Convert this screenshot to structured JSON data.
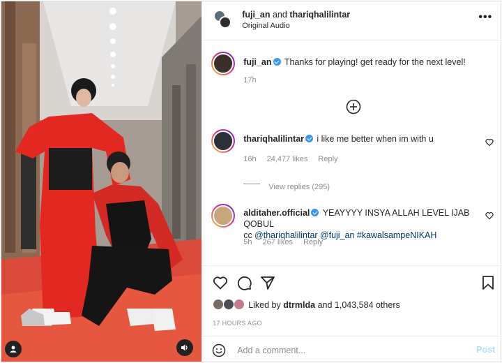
{
  "header": {
    "user1": "fuji_an",
    "joiner": "and",
    "user2": "thariqhalilintar",
    "subtitle": "Original Audio",
    "more": "•••"
  },
  "caption": {
    "username": "fuji_an",
    "text": "Thanks for playing! get ready for the next level!",
    "time": "17h"
  },
  "comments": [
    {
      "username": "thariqhalilintar",
      "text": "i like me better when im with u",
      "time": "16h",
      "likes": "24,477 likes",
      "reply": "Reply"
    },
    {
      "username": "alditaher.official",
      "line1": "YEAYYYY INSYA ALLAH LEVEL IJAB QOBUL",
      "prefix": "cc",
      "mention1": "@thariqhalilintar",
      "mention2": "@fuji_an",
      "hashtag": "#kawalsampeNIKAH",
      "time": "5h",
      "likes": "267 likes",
      "reply": "Reply"
    }
  ],
  "view_replies": "View replies (295)",
  "likes": {
    "prefix": "Liked by",
    "user": "dtrmlda",
    "suffix": "and 1,043,584 others"
  },
  "time_ago": "17 HOURS AGO",
  "add_comment": {
    "placeholder": "Add a comment...",
    "post": "Post"
  },
  "colors": {
    "accent": "#3897f0",
    "link": "#00376b",
    "muted": "#8e8e8e",
    "post_disabled": "#b2dffc"
  }
}
